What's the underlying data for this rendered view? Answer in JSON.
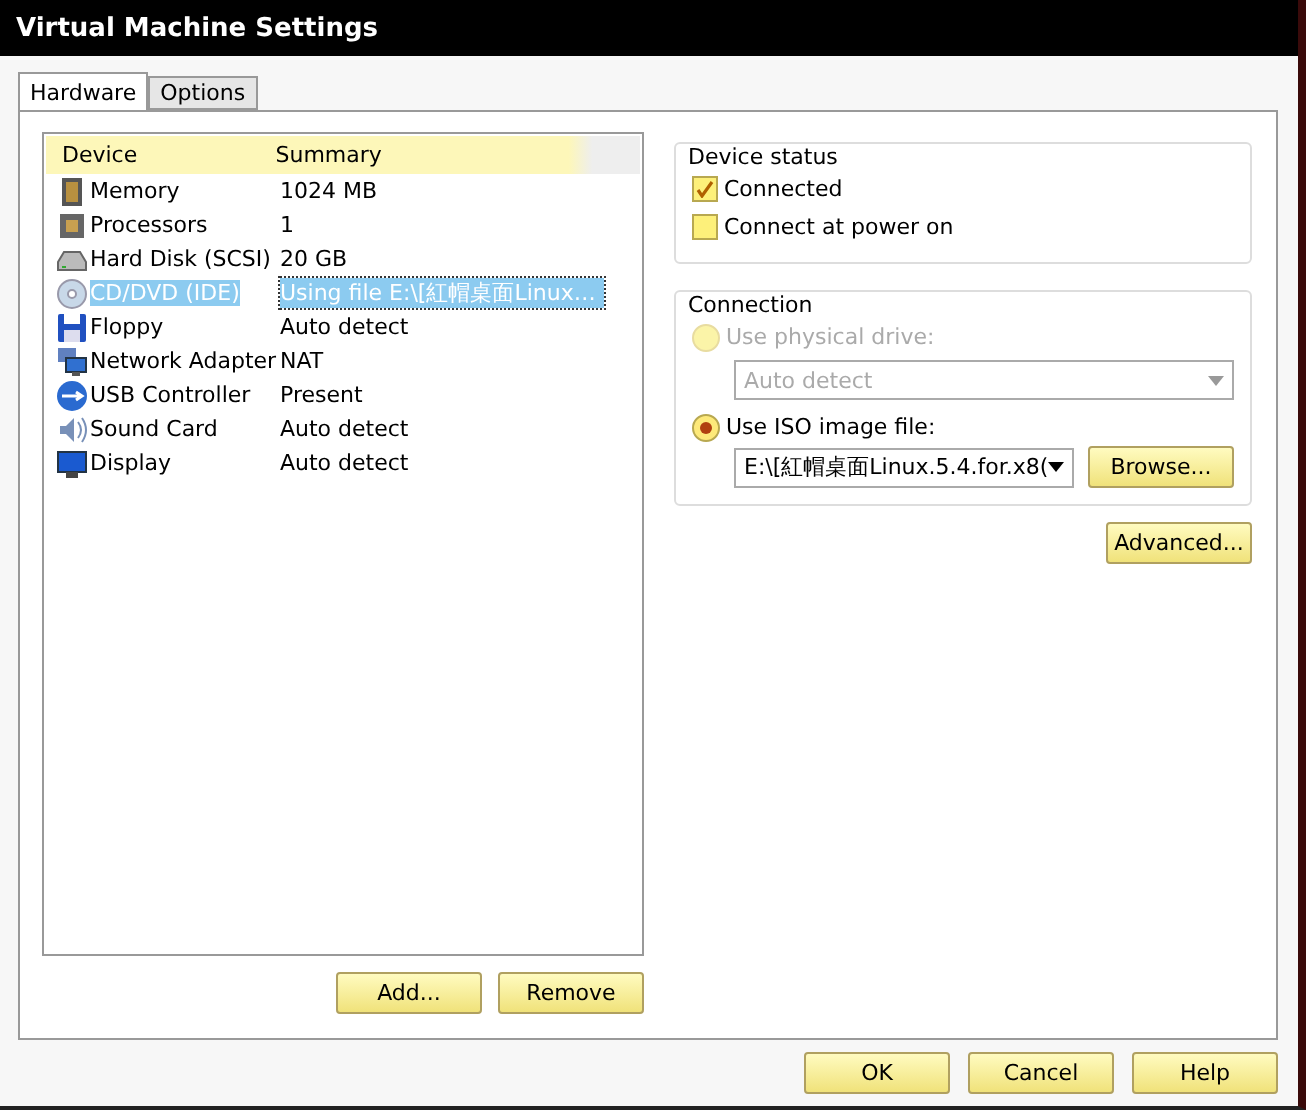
{
  "window": {
    "title": "Virtual Machine Settings"
  },
  "tabs": [
    {
      "label": "Hardware",
      "selected": true
    },
    {
      "label": "Options",
      "selected": false
    }
  ],
  "device_list": {
    "columns": [
      "Device",
      "Summary"
    ],
    "rows": [
      {
        "kind": "memory",
        "device": "Memory",
        "summary": "1024 MB",
        "selected": false
      },
      {
        "kind": "processor",
        "device": "Processors",
        "summary": "1",
        "selected": false
      },
      {
        "kind": "disk",
        "device": "Hard Disk (SCSI)",
        "summary": "20 GB",
        "selected": false
      },
      {
        "kind": "cdrom",
        "device": "CD/DVD (IDE)",
        "summary": "Using file E:\\[紅帽桌面Linux…",
        "selected": true
      },
      {
        "kind": "floppy",
        "device": "Floppy",
        "summary": "Auto detect",
        "selected": false
      },
      {
        "kind": "network",
        "device": "Network Adapter",
        "summary": "NAT",
        "selected": false
      },
      {
        "kind": "usb",
        "device": "USB Controller",
        "summary": "Present",
        "selected": false
      },
      {
        "kind": "sound",
        "device": "Sound Card",
        "summary": "Auto detect",
        "selected": false
      },
      {
        "kind": "display",
        "device": "Display",
        "summary": "Auto detect",
        "selected": false
      }
    ]
  },
  "list_buttons": [
    "Add...",
    "Remove"
  ],
  "device_status": {
    "title": "Device status",
    "options": [
      {
        "label": "Connected",
        "checked": true
      },
      {
        "label": "Connect at power on",
        "checked": false
      }
    ]
  },
  "connection": {
    "title": "Connection",
    "physical": {
      "label": "Use physical drive:",
      "selected": false,
      "disabled": true,
      "dropdown": "Auto detect"
    },
    "iso": {
      "label": "Use ISO image file:",
      "selected": true,
      "disabled": false,
      "dropdown": "E:\\[紅帽桌面Linux.5.4.for.x8(",
      "browse": "Browse..."
    }
  },
  "advanced_button": "Advanced...",
  "dialog_buttons": [
    "OK",
    "Cancel",
    "Help"
  ]
}
